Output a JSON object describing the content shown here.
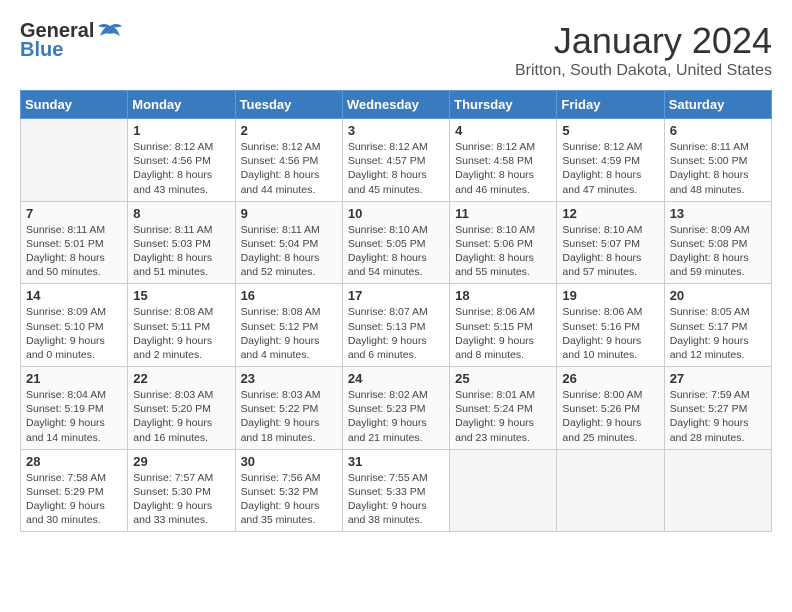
{
  "header": {
    "logo_general": "General",
    "logo_blue": "Blue",
    "month": "January 2024",
    "location": "Britton, South Dakota, United States"
  },
  "days_of_week": [
    "Sunday",
    "Monday",
    "Tuesday",
    "Wednesday",
    "Thursday",
    "Friday",
    "Saturday"
  ],
  "weeks": [
    [
      {
        "day": "",
        "sunrise": "",
        "sunset": "",
        "daylight": ""
      },
      {
        "day": "1",
        "sunrise": "Sunrise: 8:12 AM",
        "sunset": "Sunset: 4:56 PM",
        "daylight": "Daylight: 8 hours and 43 minutes."
      },
      {
        "day": "2",
        "sunrise": "Sunrise: 8:12 AM",
        "sunset": "Sunset: 4:56 PM",
        "daylight": "Daylight: 8 hours and 44 minutes."
      },
      {
        "day": "3",
        "sunrise": "Sunrise: 8:12 AM",
        "sunset": "Sunset: 4:57 PM",
        "daylight": "Daylight: 8 hours and 45 minutes."
      },
      {
        "day": "4",
        "sunrise": "Sunrise: 8:12 AM",
        "sunset": "Sunset: 4:58 PM",
        "daylight": "Daylight: 8 hours and 46 minutes."
      },
      {
        "day": "5",
        "sunrise": "Sunrise: 8:12 AM",
        "sunset": "Sunset: 4:59 PM",
        "daylight": "Daylight: 8 hours and 47 minutes."
      },
      {
        "day": "6",
        "sunrise": "Sunrise: 8:11 AM",
        "sunset": "Sunset: 5:00 PM",
        "daylight": "Daylight: 8 hours and 48 minutes."
      }
    ],
    [
      {
        "day": "7",
        "sunrise": "Sunrise: 8:11 AM",
        "sunset": "Sunset: 5:01 PM",
        "daylight": "Daylight: 8 hours and 50 minutes."
      },
      {
        "day": "8",
        "sunrise": "Sunrise: 8:11 AM",
        "sunset": "Sunset: 5:03 PM",
        "daylight": "Daylight: 8 hours and 51 minutes."
      },
      {
        "day": "9",
        "sunrise": "Sunrise: 8:11 AM",
        "sunset": "Sunset: 5:04 PM",
        "daylight": "Daylight: 8 hours and 52 minutes."
      },
      {
        "day": "10",
        "sunrise": "Sunrise: 8:10 AM",
        "sunset": "Sunset: 5:05 PM",
        "daylight": "Daylight: 8 hours and 54 minutes."
      },
      {
        "day": "11",
        "sunrise": "Sunrise: 8:10 AM",
        "sunset": "Sunset: 5:06 PM",
        "daylight": "Daylight: 8 hours and 55 minutes."
      },
      {
        "day": "12",
        "sunrise": "Sunrise: 8:10 AM",
        "sunset": "Sunset: 5:07 PM",
        "daylight": "Daylight: 8 hours and 57 minutes."
      },
      {
        "day": "13",
        "sunrise": "Sunrise: 8:09 AM",
        "sunset": "Sunset: 5:08 PM",
        "daylight": "Daylight: 8 hours and 59 minutes."
      }
    ],
    [
      {
        "day": "14",
        "sunrise": "Sunrise: 8:09 AM",
        "sunset": "Sunset: 5:10 PM",
        "daylight": "Daylight: 9 hours and 0 minutes."
      },
      {
        "day": "15",
        "sunrise": "Sunrise: 8:08 AM",
        "sunset": "Sunset: 5:11 PM",
        "daylight": "Daylight: 9 hours and 2 minutes."
      },
      {
        "day": "16",
        "sunrise": "Sunrise: 8:08 AM",
        "sunset": "Sunset: 5:12 PM",
        "daylight": "Daylight: 9 hours and 4 minutes."
      },
      {
        "day": "17",
        "sunrise": "Sunrise: 8:07 AM",
        "sunset": "Sunset: 5:13 PM",
        "daylight": "Daylight: 9 hours and 6 minutes."
      },
      {
        "day": "18",
        "sunrise": "Sunrise: 8:06 AM",
        "sunset": "Sunset: 5:15 PM",
        "daylight": "Daylight: 9 hours and 8 minutes."
      },
      {
        "day": "19",
        "sunrise": "Sunrise: 8:06 AM",
        "sunset": "Sunset: 5:16 PM",
        "daylight": "Daylight: 9 hours and 10 minutes."
      },
      {
        "day": "20",
        "sunrise": "Sunrise: 8:05 AM",
        "sunset": "Sunset: 5:17 PM",
        "daylight": "Daylight: 9 hours and 12 minutes."
      }
    ],
    [
      {
        "day": "21",
        "sunrise": "Sunrise: 8:04 AM",
        "sunset": "Sunset: 5:19 PM",
        "daylight": "Daylight: 9 hours and 14 minutes."
      },
      {
        "day": "22",
        "sunrise": "Sunrise: 8:03 AM",
        "sunset": "Sunset: 5:20 PM",
        "daylight": "Daylight: 9 hours and 16 minutes."
      },
      {
        "day": "23",
        "sunrise": "Sunrise: 8:03 AM",
        "sunset": "Sunset: 5:22 PM",
        "daylight": "Daylight: 9 hours and 18 minutes."
      },
      {
        "day": "24",
        "sunrise": "Sunrise: 8:02 AM",
        "sunset": "Sunset: 5:23 PM",
        "daylight": "Daylight: 9 hours and 21 minutes."
      },
      {
        "day": "25",
        "sunrise": "Sunrise: 8:01 AM",
        "sunset": "Sunset: 5:24 PM",
        "daylight": "Daylight: 9 hours and 23 minutes."
      },
      {
        "day": "26",
        "sunrise": "Sunrise: 8:00 AM",
        "sunset": "Sunset: 5:26 PM",
        "daylight": "Daylight: 9 hours and 25 minutes."
      },
      {
        "day": "27",
        "sunrise": "Sunrise: 7:59 AM",
        "sunset": "Sunset: 5:27 PM",
        "daylight": "Daylight: 9 hours and 28 minutes."
      }
    ],
    [
      {
        "day": "28",
        "sunrise": "Sunrise: 7:58 AM",
        "sunset": "Sunset: 5:29 PM",
        "daylight": "Daylight: 9 hours and 30 minutes."
      },
      {
        "day": "29",
        "sunrise": "Sunrise: 7:57 AM",
        "sunset": "Sunset: 5:30 PM",
        "daylight": "Daylight: 9 hours and 33 minutes."
      },
      {
        "day": "30",
        "sunrise": "Sunrise: 7:56 AM",
        "sunset": "Sunset: 5:32 PM",
        "daylight": "Daylight: 9 hours and 35 minutes."
      },
      {
        "day": "31",
        "sunrise": "Sunrise: 7:55 AM",
        "sunset": "Sunset: 5:33 PM",
        "daylight": "Daylight: 9 hours and 38 minutes."
      },
      {
        "day": "",
        "sunrise": "",
        "sunset": "",
        "daylight": ""
      },
      {
        "day": "",
        "sunrise": "",
        "sunset": "",
        "daylight": ""
      },
      {
        "day": "",
        "sunrise": "",
        "sunset": "",
        "daylight": ""
      }
    ]
  ]
}
